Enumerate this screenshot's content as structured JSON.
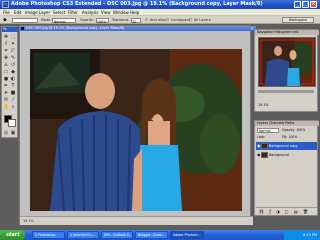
{
  "window": {
    "title": "Adobe Photoshop CS3 Extended - DSC 003.jpg @ 19.1% (Background copy, Layer Mask/8)",
    "app_icon": "Ps"
  },
  "menu": [
    "File",
    "Edit",
    "Image",
    "Layer",
    "Select",
    "Filter",
    "Analysis",
    "View",
    "Window",
    "Help"
  ],
  "options_bar": {
    "mode_label": "Mode:",
    "mode_value": "Normal",
    "opacity_label": "Opacity:",
    "opacity_value": "100%",
    "tolerance_label": "Tolerance:",
    "tolerance_value": "32",
    "antialias_label": "Anti-alias",
    "contiguous_label": "Contiguous",
    "all_layers_label": "All Layers",
    "workspace_label": "Workspace"
  },
  "toolbox": {
    "header": "Ps"
  },
  "document": {
    "title": "DSC 003.jpg @ 19.1% (Background copy, Layer Mask/8)",
    "status": "19.1%"
  },
  "navigator_panel": {
    "tabs": "Navigator  Histogram  Info",
    "zoom": "19.1%"
  },
  "layers_panel": {
    "tabs": "Layers  Channels  Paths",
    "blend_mode": "Normal",
    "opacity_label": "Opacity: 100%",
    "lock_label": "Lock:",
    "fill_label": "Fill: 100%",
    "layers": [
      {
        "name": "Background copy",
        "selected": true
      },
      {
        "name": "Background",
        "selected": false
      }
    ]
  },
  "taskbar": {
    "start_label": "start",
    "tasks": [
      "2 Photoshop",
      "2 Internet Ex...",
      "IEM - Outlook E...",
      "Blogger: Creat...",
      "Adobe Photosh..."
    ],
    "clock": "4:43 PM"
  }
}
